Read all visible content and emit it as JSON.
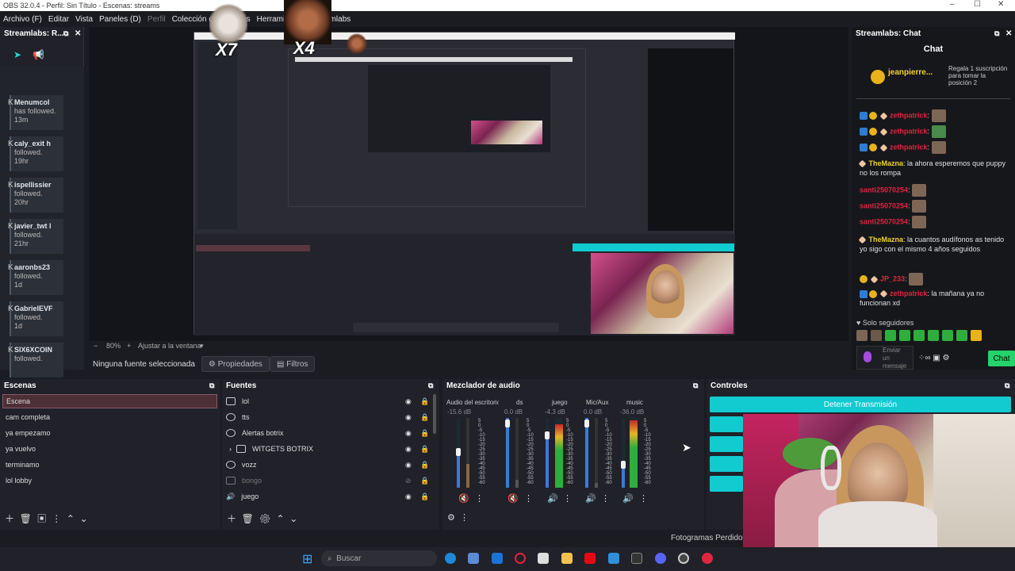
{
  "titlebar": {
    "title": "OBS 32.0.4 - Perfil: Sin Título - Escenas: streams"
  },
  "menu": [
    "Archivo (F)",
    "Editar",
    "Vista",
    "Paneles (D)",
    "Perfil",
    "Colección de Escenas",
    "Herramientas",
    "Streamlabs"
  ],
  "left_dock": {
    "title": "Streamlabs: R...",
    "events": [
      {
        "name": "Menumcol",
        "action": "has followed.",
        "time": "13m"
      },
      {
        "name": "caly_exit h",
        "action": "followed.",
        "time": "19hr"
      },
      {
        "name": "ispellissier",
        "action": "followed.",
        "time": "20hr"
      },
      {
        "name": "javier_twt l",
        "action": "followed.",
        "time": "21hr"
      },
      {
        "name": "aaronbs23",
        "action": "followed.",
        "time": "1d"
      },
      {
        "name": "GabrielEVF",
        "action": "followed.",
        "time": "1d"
      },
      {
        "name": "SIX6XCOIN",
        "action": "followed.",
        "time": ""
      }
    ]
  },
  "overlay": {
    "x7": "X7",
    "x4": "X4"
  },
  "preview": {
    "zoom": "80%",
    "fit": "Ajustar a la ventana",
    "no_source": "Ninguna fuente seleccionada",
    "properties": "Propiedades",
    "filters": "Filtros"
  },
  "chat": {
    "dock_title": "Streamlabs: Chat",
    "title": "Chat",
    "top_user": "jeanpierre...",
    "top_note": "Regala 1 suscripción para tomar la posición 2",
    "messages": [
      {
        "user": "zethpatrick",
        "text": ":"
      },
      {
        "user": "zethpatrick",
        "text": ":"
      },
      {
        "user": "zethpatrick",
        "text": ":"
      },
      {
        "user": "TheMazna",
        "text": ": la ahora esperemos que puppy no los rompa"
      },
      {
        "user": "santi25070254",
        "text": ":"
      },
      {
        "user": "santi25070254",
        "text": ":"
      },
      {
        "user": "santi25070254",
        "text": ":"
      },
      {
        "user": "TheMazna",
        "text": ": la cuantos audífonos as tenido yo sigo con el mismo 4 años seguidos"
      },
      {
        "user": "JP_233",
        "text": ":"
      },
      {
        "user": "zethpatrick",
        "text": ": la mañana ya no funcionan xd"
      }
    ],
    "followers_only": "Solo seguidores",
    "send_placeholder": "Enviar un mensaje",
    "send": "Chat"
  },
  "scenes": {
    "title": "Escenas",
    "items": [
      "Escena",
      "cam completa",
      "ya empezamo",
      "ya vuelvo",
      "terminamo",
      "lol lobby"
    ],
    "selected": 0
  },
  "sources": {
    "title": "Fuentes",
    "items": [
      {
        "label": "lol",
        "icon": "monitor-icon"
      },
      {
        "label": "tts",
        "icon": "browser-icon"
      },
      {
        "label": "Alertas botrix",
        "icon": "browser-icon"
      },
      {
        "label": "WITGETS BOTRIX",
        "icon": "folder-icon"
      },
      {
        "label": "vozz",
        "icon": "browser-icon"
      },
      {
        "label": "bongo",
        "icon": "image-icon"
      },
      {
        "label": "juego",
        "icon": "speaker-icon"
      }
    ]
  },
  "mixer": {
    "title": "Mezclador de audio",
    "channels": [
      {
        "name": "Audio del escritorio",
        "db": "-15.6 dB"
      },
      {
        "name": "ds",
        "db": "0.0 dB"
      },
      {
        "name": "juego",
        "db": "-4.3 dB"
      },
      {
        "name": "Mic/Aux",
        "db": "0.0 dB"
      },
      {
        "name": "music",
        "db": "-36.0 dB"
      }
    ],
    "scale": [
      "5",
      "0",
      "-5",
      "-10",
      "-15",
      "-20",
      "-25",
      "-30",
      "-35",
      "-40",
      "-45",
      "-50",
      "-55",
      "-60"
    ]
  },
  "controls": {
    "title": "Controles",
    "stop": "Detener Transmisión",
    "dropped": "Fotogramas Perdidos 0"
  },
  "taskbar": {
    "search": "Buscar"
  },
  "colors": {
    "accent": "#11cbd1",
    "chat_green": "#25d36b",
    "selected_scene": "#4d2f37"
  }
}
